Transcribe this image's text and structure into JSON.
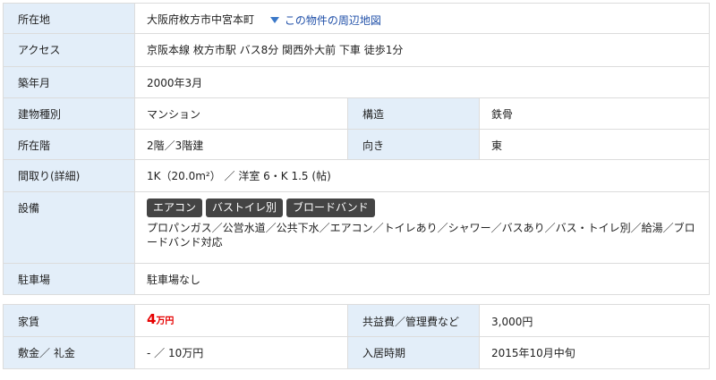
{
  "rows": {
    "location": {
      "label": "所在地",
      "value": "大阪府枚方市中宮本町",
      "map_link": "この物件の周辺地図"
    },
    "access": {
      "label": "アクセス",
      "value": "京阪本線 枚方市駅 バス8分 関西外大前 下車 徒歩1分"
    },
    "built": {
      "label": "築年月",
      "value": "2000年3月"
    },
    "building_type": {
      "label": "建物種別",
      "value": "マンション",
      "label2": "構造",
      "value2": "鉄骨"
    },
    "floor": {
      "label": "所在階",
      "value": "2階／3階建",
      "label2": "向き",
      "value2": "東"
    },
    "layout": {
      "label": "間取り(詳細)",
      "value": "1K（20.0m²） ／ 洋室 6・K 1.5 (帖)"
    },
    "facilities": {
      "label": "設備",
      "tags": [
        "エアコン",
        "バストイレ別",
        "ブロードバンド"
      ],
      "description": "プロパンガス／公営水道／公共下水／エアコン／トイレあり／シャワー／バスあり／バス・トイレ別／給湯／ブロードバンド対応"
    },
    "parking": {
      "label": "駐車場",
      "value": "駐車場なし"
    }
  },
  "fees": {
    "rent": {
      "label": "家賃",
      "amount": "4",
      "unit": "万円",
      "label2": "共益費／管理費など",
      "value2": "3,000円"
    },
    "deposit": {
      "label": "敷金／ 礼金",
      "value": "- ／ 10万円",
      "label2": "入居時期",
      "value2": "2015年10月中旬"
    }
  }
}
